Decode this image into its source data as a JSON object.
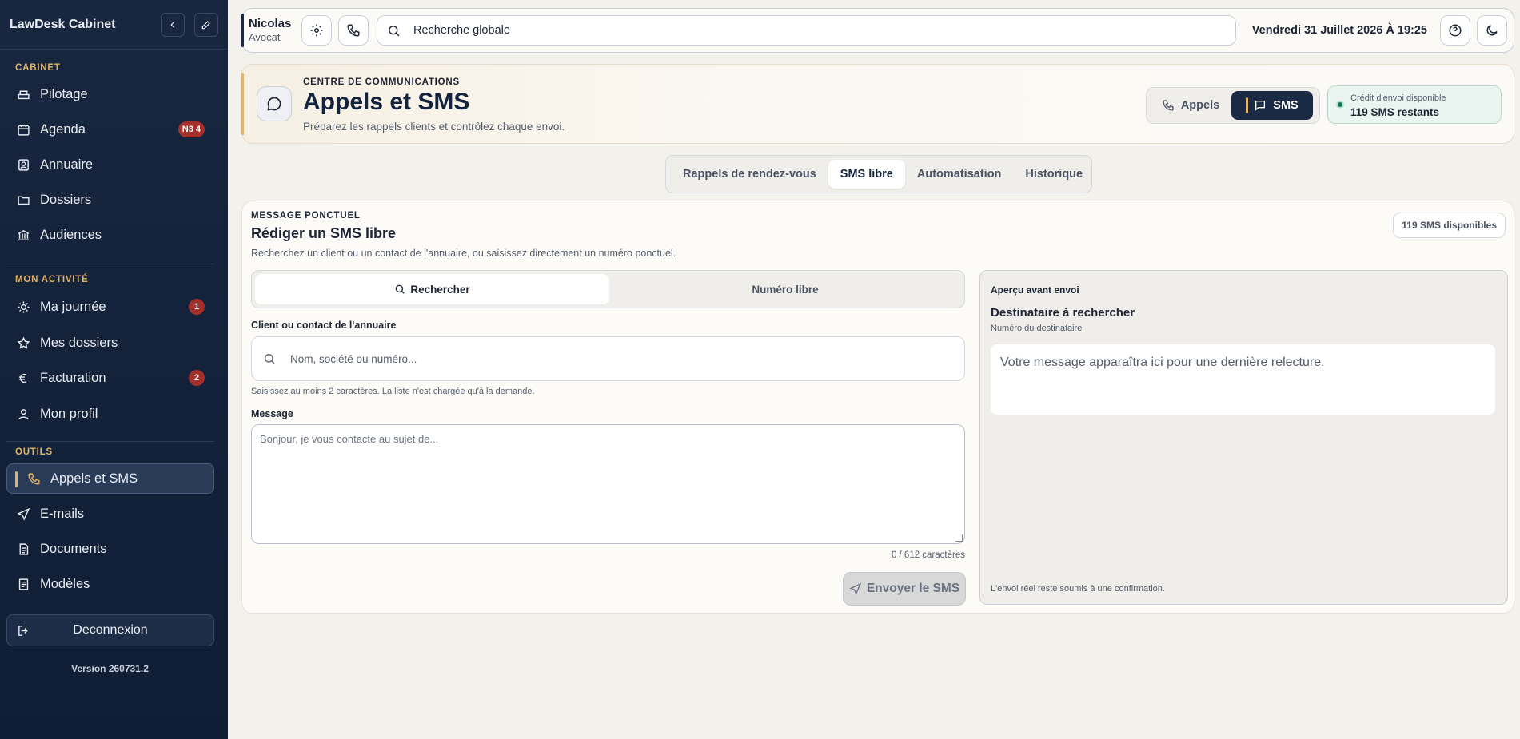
{
  "sidebar": {
    "brand": "LawDesk Cabinet",
    "sections": {
      "cabinet": "CABINET",
      "activite": "MON ACTIVITÉ",
      "outils": "OUTILS"
    },
    "items": [
      {
        "label": "Pilotage",
        "icon": "dashboard-icon"
      },
      {
        "label": "Agenda",
        "icon": "calendar-icon",
        "badge": "N3 4"
      },
      {
        "label": "Annuaire",
        "icon": "contacts-icon"
      },
      {
        "label": "Dossiers",
        "icon": "folder-icon"
      },
      {
        "label": "Audiences",
        "icon": "courthouse-icon"
      },
      {
        "label": "Ma journée",
        "icon": "sun-icon",
        "badge": "1"
      },
      {
        "label": "Mes dossiers",
        "icon": "star-icon"
      },
      {
        "label": "Facturation",
        "icon": "euro-icon",
        "badge": "2"
      },
      {
        "label": "Mon profil",
        "icon": "user-icon"
      },
      {
        "label": "Appels et SMS",
        "icon": "phone-icon",
        "active": true
      },
      {
        "label": "E-mails",
        "icon": "send-icon"
      },
      {
        "label": "Documents",
        "icon": "document-icon"
      },
      {
        "label": "Modèles",
        "icon": "template-icon"
      }
    ],
    "logout": "Deconnexion",
    "version": "Version 260731.2"
  },
  "topbar": {
    "user_name": "Nicolas",
    "user_role": "Avocat",
    "search_placeholder": "Recherche globale",
    "date": "Vendredi 31 Juillet 2026 À 19:25"
  },
  "header": {
    "eyebrow": "CENTRE DE COMMUNICATIONS",
    "title": "Appels et SMS",
    "subtitle": "Préparez les rappels clients et contrôlez chaque envoi.",
    "switch_calls": "Appels",
    "switch_sms": "SMS",
    "credit_label": "Crédit d'envoi disponible",
    "credit_value": "119 SMS restants"
  },
  "tabs": [
    "Rappels de rendez-vous",
    "SMS libre",
    "Automatisation",
    "Historique"
  ],
  "active_tab": "SMS libre",
  "composer": {
    "eyebrow": "MESSAGE PONCTUEL",
    "title": "Rédiger un SMS libre",
    "subtitle": "Recherchez un client ou un contact de l'annuaire, ou saisissez directement un numéro ponctuel.",
    "available_badge": "119 SMS disponibles",
    "mode_search": "Rechercher",
    "mode_free": "Numéro libre",
    "recipient_label": "Client ou contact de l'annuaire",
    "recipient_placeholder": "Nom, société ou numéro...",
    "recipient_hint": "Saisissez au moins 2 caractères. La liste n'est chargée qu'à la demande.",
    "message_label": "Message",
    "message_placeholder": "Bonjour, je vous contacte au sujet de...",
    "char_count": "0 / 612 caractères",
    "send_label": "Envoyer le SMS"
  },
  "preview": {
    "heading": "Aperçu avant envoi",
    "recipient": "Destinataire à rechercher",
    "recipient_sub": "Numéro du destinataire",
    "message": "Votre message apparaîtra ici pour une dernière relecture.",
    "footer": "L'envoi réel reste soumis à une confirmation."
  },
  "colors": {
    "navy": "#1a2a44",
    "gold": "#e0b36a",
    "badge_red": "#a4302b",
    "success_green": "#0f7a5a"
  }
}
